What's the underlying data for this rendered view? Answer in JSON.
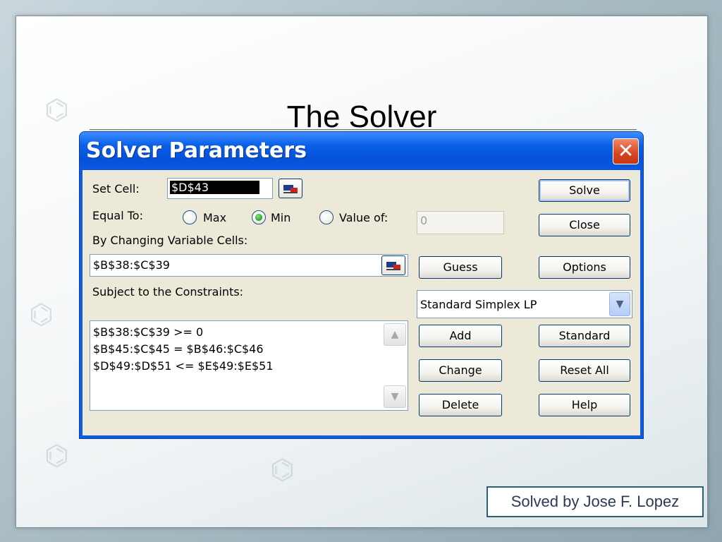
{
  "slide": {
    "title": "The Solver",
    "credit": "Solved by Jose F. Lopez"
  },
  "dialog": {
    "title": "Solver Parameters",
    "close_glyph": "✕",
    "set_cell": {
      "label": "Set Cell:",
      "value": "$D$43"
    },
    "equal_to": {
      "label": "Equal To:",
      "options": [
        {
          "label": "Max",
          "selected": false
        },
        {
          "label": "Min",
          "selected": true
        },
        {
          "label": "Value of:",
          "selected": false
        }
      ],
      "value_of": "0"
    },
    "changing_cells": {
      "label": "By Changing Variable Cells:",
      "value": "$B$38:$C$39"
    },
    "constraints": {
      "label": "Subject to the Constraints:",
      "items": [
        "$B$38:$C$39 >= 0",
        "$B$45:$C$45 = $B$46:$C$46",
        "$D$49:$D$51 <= $E$49:$E$51"
      ]
    },
    "engine": {
      "selected": "Standard Simplex LP"
    },
    "buttons": {
      "solve": "Solve",
      "close": "Close",
      "guess": "Guess",
      "options": "Options",
      "add": "Add",
      "standard": "Standard",
      "change": "Change",
      "reset_all": "Reset All",
      "delete": "Delete",
      "help": "Help"
    }
  }
}
